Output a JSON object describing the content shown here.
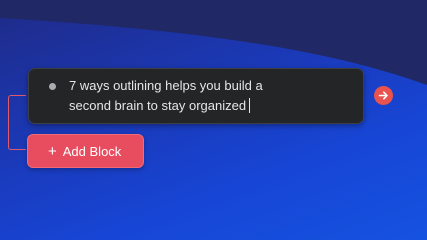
{
  "block": {
    "line1": "7 ways outlining helps you build a",
    "line2": "second brain to stay organized"
  },
  "actions": {
    "add_block_label": "Add Block",
    "add_icon": "+"
  },
  "icons": {
    "bullet": "bullet-dot-icon",
    "submit": "arrow-right-icon"
  },
  "colors": {
    "accent": "#e84c5f",
    "card_bg": "#232527",
    "background_top": "#1f2a86",
    "background_bottom": "#1652e0"
  }
}
